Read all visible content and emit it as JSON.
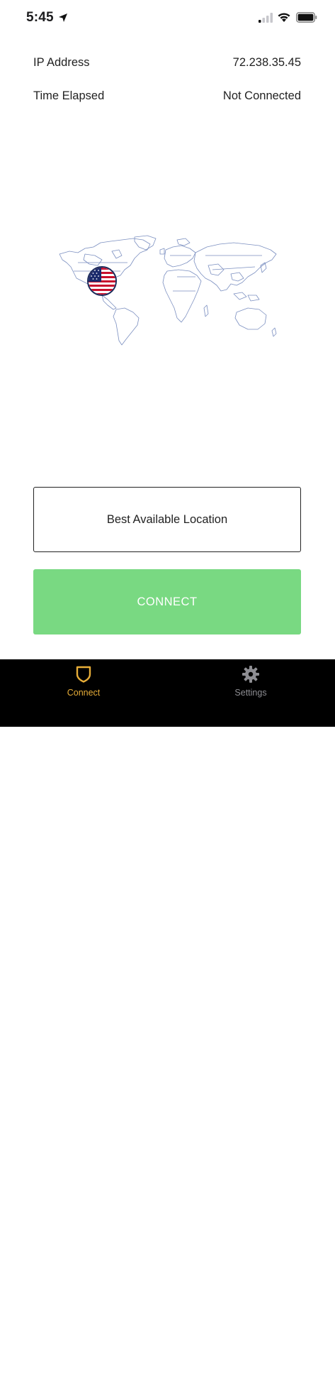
{
  "status_bar": {
    "time": "5:45"
  },
  "info": {
    "ip_label": "IP Address",
    "ip_value": "72.238.35.45",
    "time_label": "Time Elapsed",
    "time_value": "Not Connected"
  },
  "map": {
    "marker_country_icon": "us-flag-icon"
  },
  "location_button": {
    "label": "Best Available Location"
  },
  "connect_button": {
    "label": "CONNECT",
    "color": "#79d982"
  },
  "tab_bar": {
    "tabs": [
      {
        "label": "Connect",
        "icon": "shield-icon",
        "active": true,
        "color": "#e7ad38"
      },
      {
        "label": "Settings",
        "icon": "gear-icon",
        "active": false,
        "color": "#8e8e93"
      }
    ]
  }
}
